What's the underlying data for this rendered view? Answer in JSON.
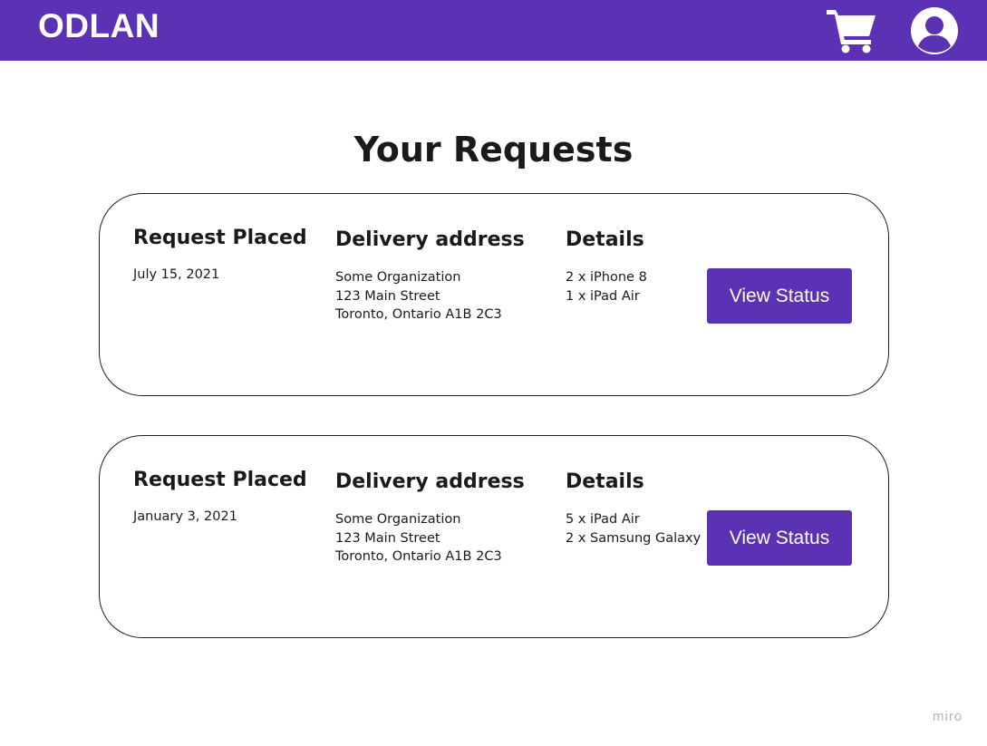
{
  "header": {
    "brand": "ODLAN",
    "icons": {
      "cart": "shopping-cart-icon",
      "account": "user-account-icon"
    },
    "colors": {
      "brand_bg": "#5b32b4",
      "icon": "#ffffff"
    }
  },
  "main": {
    "title": "Your Requests",
    "requests": [
      {
        "placed_label": "Request Placed",
        "placed_date": "July 15, 2021",
        "address_label": "Delivery address",
        "address_lines": [
          "Some Organization",
          "123 Main Street",
          "Toronto, Ontario A1B 2C3"
        ],
        "details_label": "Details",
        "details_lines": [
          "2 x iPhone 8",
          "1 x iPad Air"
        ],
        "button_label": "View Status"
      },
      {
        "placed_label": "Request Placed",
        "placed_date": "January 3, 2021",
        "address_label": "Delivery address",
        "address_lines": [
          "Some Organization",
          "123 Main Street",
          "Toronto, Ontario A1B 2C3"
        ],
        "details_label": "Details",
        "details_lines": [
          "5 x iPad Air",
          "2 x Samsung Galaxy"
        ],
        "button_label": "View Status"
      }
    ]
  },
  "watermark": "miro",
  "colors": {
    "accent": "#5b32b4",
    "text": "#1a1a1a",
    "card_border": "#1f1f1f",
    "watermark": "#b5b5b5"
  }
}
